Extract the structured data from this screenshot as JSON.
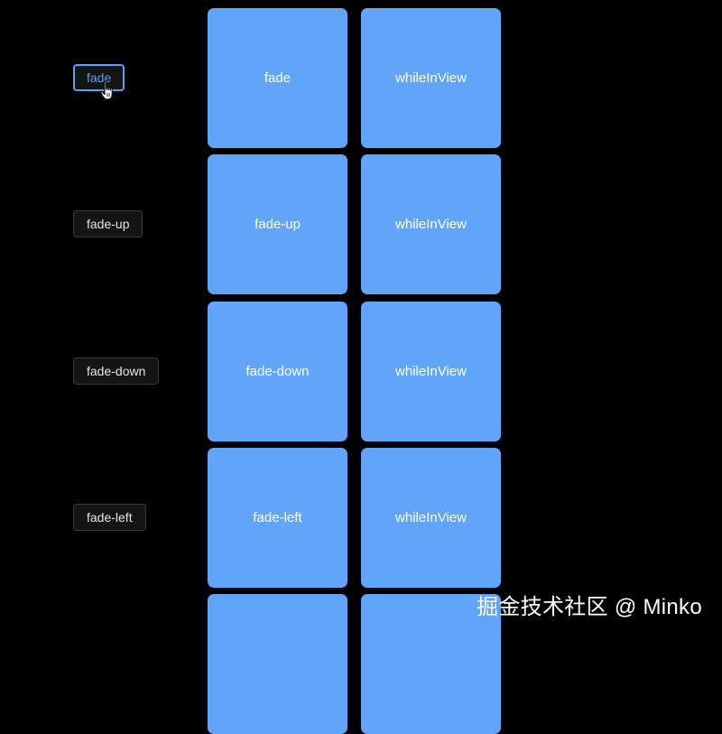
{
  "buttons": [
    {
      "label": "fade",
      "active": true
    },
    {
      "label": "fade-up",
      "active": false
    },
    {
      "label": "fade-down",
      "active": false
    },
    {
      "label": "fade-left",
      "active": false
    }
  ],
  "boxes": [
    {
      "effect": "fade",
      "trigger": "whileInView"
    },
    {
      "effect": "fade-up",
      "trigger": "whileInView"
    },
    {
      "effect": "fade-down",
      "trigger": "whileInView"
    },
    {
      "effect": "fade-left",
      "trigger": "whileInView"
    },
    {
      "effect": "",
      "trigger": ""
    }
  ],
  "watermark": "掘金技术社区 @ Minko",
  "colors": {
    "background": "#000000",
    "box": "#60a5fa",
    "active_accent": "#5aa0f5",
    "button_bg": "#141414"
  },
  "cursor": "hand-pointer-icon"
}
